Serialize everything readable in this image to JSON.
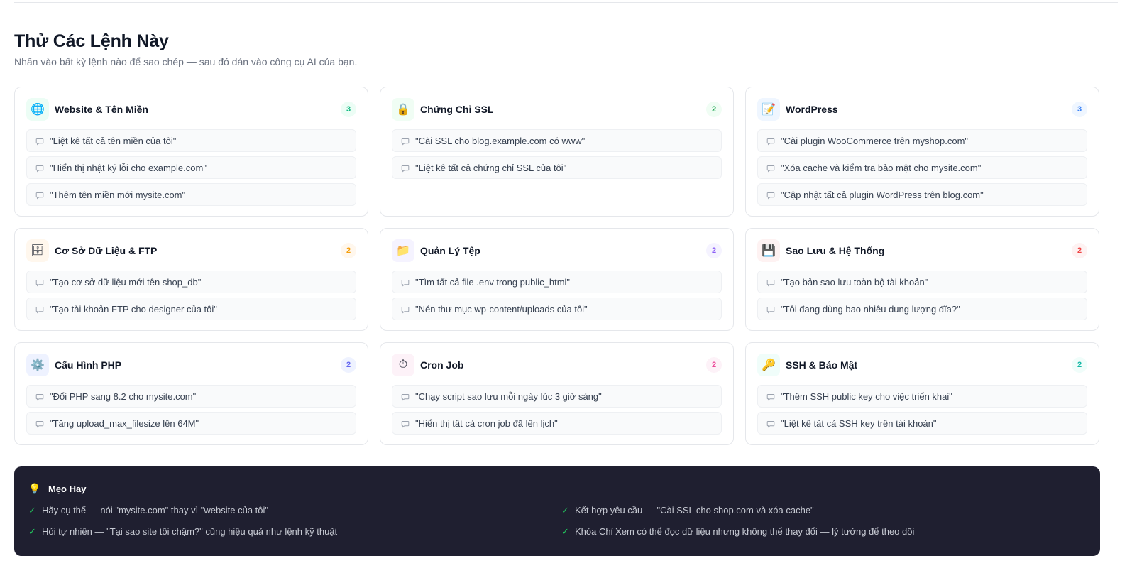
{
  "section": {
    "title": "Thử Các Lệnh Này",
    "subtitle": "Nhấn vào bất kỳ lệnh nào để sao chép — sau đó dán vào công cụ AI của bạn."
  },
  "categories": [
    {
      "icon": "globe-icon",
      "glyph": "🌐",
      "name": "Website & Tên Miền",
      "count": "3",
      "accent": "#10b981",
      "bg": "#ecfdf5",
      "commands": [
        "\"Liệt kê tất cả tên miền của tôi\"",
        "\"Hiển thị nhật ký lỗi cho example.com\"",
        "\"Thêm tên miền mới mysite.com\""
      ]
    },
    {
      "icon": "lock-icon",
      "glyph": "🔒",
      "name": "Chứng Chỉ SSL",
      "count": "2",
      "accent": "#16a34a",
      "bg": "#f0fdf4",
      "commands": [
        "\"Cài SSL cho blog.example.com có www\"",
        "\"Liệt kê tất cả chứng chỉ SSL của tôi\""
      ]
    },
    {
      "icon": "memo-icon",
      "glyph": "📝",
      "name": "WordPress",
      "count": "3",
      "accent": "#3b82f6",
      "bg": "#eff6ff",
      "commands": [
        "\"Cài plugin WooCommerce trên myshop.com\"",
        "\"Xóa cache và kiểm tra bảo mật cho mysite.com\"",
        "\"Cập nhật tất cả plugin WordPress trên blog.com\""
      ]
    },
    {
      "icon": "database-icon",
      "glyph": "🗄",
      "name": "Cơ Sở Dữ Liệu & FTP",
      "count": "2",
      "accent": "#f59e0b",
      "bg": "#fff7ed",
      "commands": [
        "\"Tạo cơ sở dữ liệu mới tên shop_db\"",
        "\"Tạo tài khoản FTP cho designer của tôi\""
      ]
    },
    {
      "icon": "folder-icon",
      "glyph": "📁",
      "name": "Quản Lý Tệp",
      "count": "2",
      "accent": "#8b5cf6",
      "bg": "#f5f3ff",
      "commands": [
        "\"Tìm tất cả file .env trong public_html\"",
        "\"Nén thư mục wp-content/uploads của tôi\""
      ]
    },
    {
      "icon": "floppy-disk-icon",
      "glyph": "💾",
      "name": "Sao Lưu & Hệ Thống",
      "count": "2",
      "accent": "#ef4444",
      "bg": "#fef2f2",
      "commands": [
        "\"Tạo bản sao lưu toàn bộ tài khoản\"",
        "\"Tôi đang dùng bao nhiêu dung lượng đĩa?\""
      ]
    },
    {
      "icon": "gear-icon",
      "glyph": "⚙️",
      "name": "Cấu Hình PHP",
      "count": "2",
      "accent": "#6366f1",
      "bg": "#eef2ff",
      "commands": [
        "\"Đổi PHP sang 8.2 cho mysite.com\"",
        "\"Tăng upload_max_filesize lên 64M\""
      ]
    },
    {
      "icon": "stopwatch-icon",
      "glyph": "⏱",
      "name": "Cron Job",
      "count": "2",
      "accent": "#ec4899",
      "bg": "#fdf2f8",
      "commands": [
        "\"Chạy script sao lưu mỗi ngày lúc 3 giờ sáng\"",
        "\"Hiển thị tất cả cron job đã lên lịch\""
      ]
    },
    {
      "icon": "key-icon",
      "glyph": "🔑",
      "name": "SSH & Bảo Mật",
      "count": "2",
      "accent": "#14b8a6",
      "bg": "#f0fdfa",
      "commands": [
        "\"Thêm SSH public key cho việc triển khai\"",
        "\"Liệt kê tất cả SSH key trên tài khoản\""
      ]
    }
  ],
  "tips": {
    "icon": "lightbulb-icon",
    "title": "Mẹo Hay",
    "items": [
      "Hãy cụ thể — nói \"mysite.com\" thay vì \"website của tôi\"",
      "Kết hợp yêu cầu — \"Cài SSL cho shop.com và xóa cache\"",
      "Hỏi tự nhiên — \"Tại sao site tôi chậm?\" cũng hiệu quả như lệnh kỹ thuật",
      "Khóa Chỉ Xem có thể đọc dữ liệu nhưng không thể thay đổi — lý tưởng để theo dõi"
    ]
  }
}
